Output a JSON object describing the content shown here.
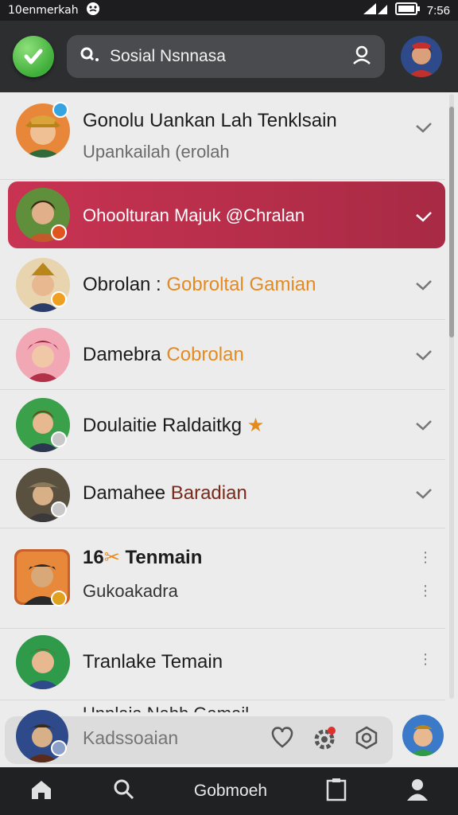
{
  "status_bar": {
    "carrier": "10enmerkah",
    "time": "7:56"
  },
  "header": {
    "search_text": "Sosial Nsnnasa"
  },
  "chats": [
    {
      "title": "Gonolu Uankan Lah Tenklsain",
      "subtitle": "Upankailah (erolah"
    },
    {
      "title": "Ohoolturan Majuk @Chralan",
      "highlighted": true
    },
    {
      "title_prefix": "Obrolan :",
      "title_suffix": "Gobroltal Gamian"
    },
    {
      "title_prefix": "Damebra",
      "title_suffix": "Cobrolan"
    },
    {
      "title": "Doulaitie Raldaitkg"
    },
    {
      "title_prefix": "Damahee",
      "title_suffix": "Baradian"
    },
    {
      "title": "Tenmain",
      "title_prefix": "16",
      "subtitle": "Gukoakadra"
    },
    {
      "title": "Tranlake Temain"
    }
  ],
  "compose": {
    "partial_text": "Unnlaia Nahh Gamail",
    "placeholder": "Kadssoaian"
  },
  "bottom_nav": {
    "center_label": "Gobmoeh"
  },
  "colors": {
    "accent": "#b82e4b",
    "orange_text": "#e58a1f",
    "top_bar": "#2d2e30",
    "nav_bar": "#202123"
  }
}
